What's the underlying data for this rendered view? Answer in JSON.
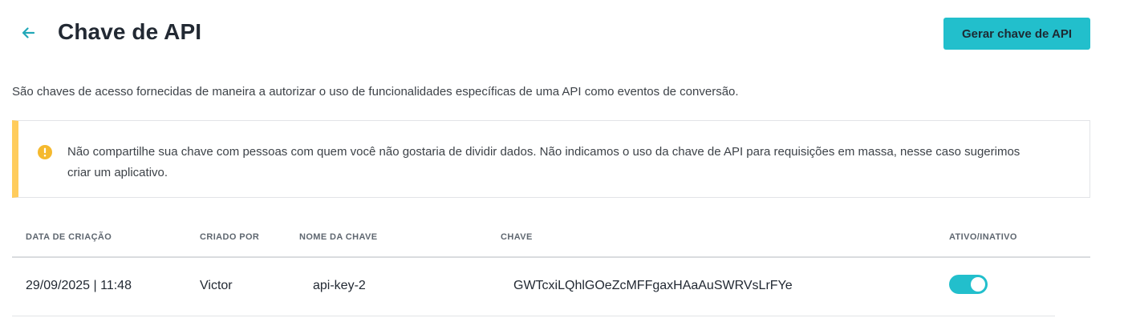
{
  "header": {
    "title": "Chave de API",
    "back_icon": "arrow-left-icon",
    "generate_button_label": "Gerar chave de API"
  },
  "description": "São chaves de acesso fornecidas de maneira a autorizar o uso de funcionalidades específicas de uma API como eventos de conversão.",
  "alert": {
    "icon": "warning-icon",
    "text": "Não compartilhe sua chave com pessoas com quem você não gostaria de dividir dados. Não indicamos o uso da chave de API para requisições em massa, nesse caso sugerimos criar um aplicativo."
  },
  "table": {
    "columns": [
      "DATA DE CRIAÇÃO",
      "CRIADO POR",
      "NOME DA CHAVE",
      "CHAVE",
      "ATIVO/INATIVO"
    ],
    "rows": [
      {
        "created_at": "29/09/2025 | 11:48",
        "created_by": "Victor",
        "key_name": "api-key-2",
        "key": "GWTcxiLQhlGOeZcMFFgaxHAaAuSWRVsLrFYe",
        "active": true
      }
    ]
  },
  "colors": {
    "accent": "#22bfcc",
    "warning": "#ffcc5c",
    "warning_icon": "#f5b92e",
    "title": "#222933"
  }
}
